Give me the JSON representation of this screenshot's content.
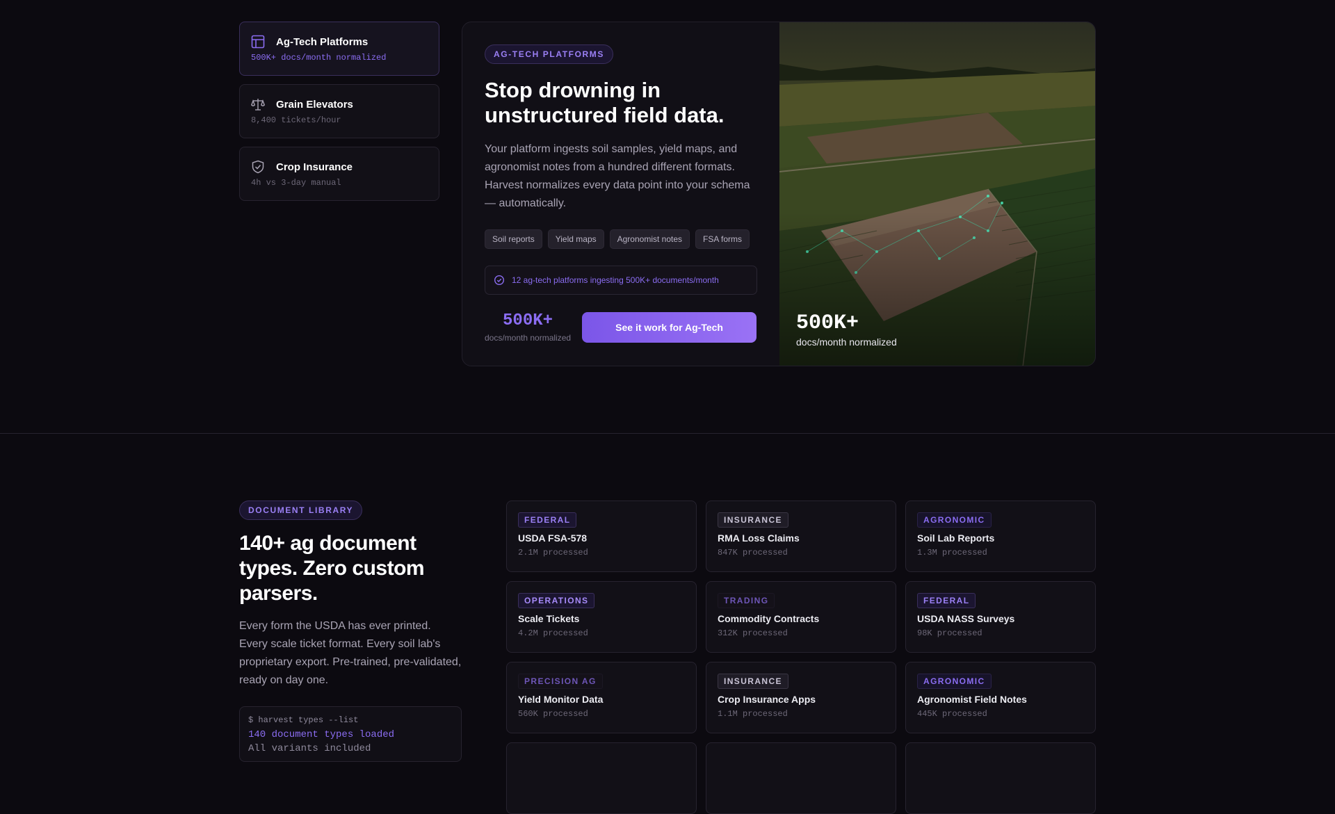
{
  "sidebar": {
    "items": [
      {
        "title": "Ag-Tech Platforms",
        "sub": "500K+ docs/month normalized",
        "icon": "layout-icon"
      },
      {
        "title": "Grain Elevators",
        "sub": "8,400 tickets/hour",
        "icon": "scale-icon"
      },
      {
        "title": "Crop Insurance",
        "sub": "4h vs 3-day manual",
        "icon": "shield-icon"
      }
    ]
  },
  "hero": {
    "pill": "AG-TECH PLATFORMS",
    "title": "Stop drowning in unstructured field data.",
    "description": "Your platform ingests soil samples, yield maps, and agronomist notes from a hundred different formats. Harvest normalizes every data point into your schema — automatically.",
    "tags": [
      "Soil reports",
      "Yield maps",
      "Agronomist notes",
      "FSA forms"
    ],
    "notice": "12 ag-tech platforms ingesting 500K+ documents/month",
    "stat_value": "500K+",
    "stat_label": "docs/month normalized",
    "cta": "See it work for Ag-Tech",
    "photo_stat_value": "500K+",
    "photo_stat_label": "docs/month normalized"
  },
  "library": {
    "pill": "DOCUMENT LIBRARY",
    "title": "140+ ag document types. Zero custom parsers.",
    "description": "Every form the USDA has ever printed. Every scale ticket format. Every soil lab's proprietary export. Pre-trained, pre-validated, ready on day one.",
    "terminal": {
      "command": "$ harvest types --list",
      "line2": "140 document types loaded",
      "line3": "All variants included"
    },
    "docs": [
      {
        "badge": "FEDERAL",
        "name": "USDA FSA-578",
        "count": "2.1M processed",
        "color": "#9b80f5",
        "bg": "#1b1530",
        "border": "#3a2f5c"
      },
      {
        "badge": "INSURANCE",
        "name": "RMA Loss Claims",
        "count": "847K processed",
        "color": "#c9c4d6",
        "bg": "#1f1c26",
        "border": "#3a3644"
      },
      {
        "badge": "AGRONOMIC",
        "name": "Soil Lab Reports",
        "count": "1.3M processed",
        "color": "#8b6df2",
        "bg": "#17132a",
        "border": "#2a2247"
      },
      {
        "badge": "OPERATIONS",
        "name": "Scale Tickets",
        "count": "4.2M processed",
        "color": "#a78bfa",
        "bg": "#1b1530",
        "border": "#3a2f5c"
      },
      {
        "badge": "TRADING",
        "name": "Commodity Contracts",
        "count": "312K processed",
        "color": "#6e56b8",
        "bg": "#141119",
        "border": "#1c1824"
      },
      {
        "badge": "FEDERAL",
        "name": "USDA NASS Surveys",
        "count": "98K processed",
        "color": "#9b80f5",
        "bg": "#1b1530",
        "border": "#3a2f5c"
      },
      {
        "badge": "PRECISION AG",
        "name": "Yield Monitor Data",
        "count": "560K processed",
        "color": "#6e56b8",
        "bg": "#141119",
        "border": "#1c1824"
      },
      {
        "badge": "INSURANCE",
        "name": "Crop Insurance Apps",
        "count": "1.1M processed",
        "color": "#c9c4d6",
        "bg": "#1f1c26",
        "border": "#3a3644"
      },
      {
        "badge": "AGRONOMIC",
        "name": "Agronomist Field Notes",
        "count": "445K processed",
        "color": "#8b6df2",
        "bg": "#17132a",
        "border": "#2a2247"
      }
    ]
  }
}
